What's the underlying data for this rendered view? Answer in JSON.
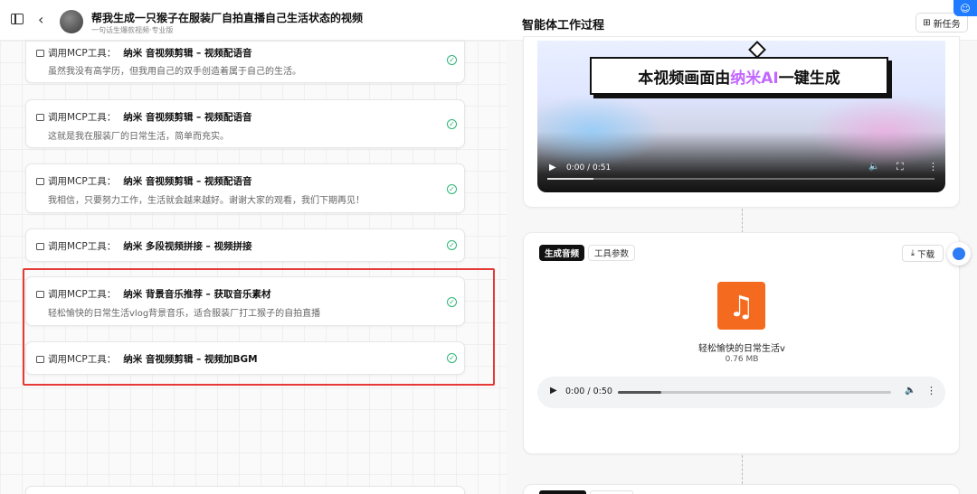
{
  "header": {
    "title": "帮我生成一只猴子在服装厂自拍直播自己生活状态的视频",
    "subtitle": "一句话生爆款视频·专业版",
    "center_title": "智能体工作过程",
    "new_task_label": "新任务",
    "corner_icon": "robot-icon"
  },
  "steps": [
    {
      "prefix": "调用MCP工具：",
      "tool": "纳米 音视频剪辑 – 视频配语音",
      "desc": "虽然我没有高学历，但我用自己的双手创造着属于自己的生活。"
    },
    {
      "prefix": "调用MCP工具：",
      "tool": "纳米 音视频剪辑 – 视频配语音",
      "desc": "这就是我在服装厂的日常生活，简单而充实。"
    },
    {
      "prefix": "调用MCP工具：",
      "tool": "纳米 音视频剪辑 – 视频配语音",
      "desc": "我相信，只要努力工作，生活就会越来越好。谢谢大家的观看，我们下期再见！"
    },
    {
      "prefix": "调用MCP工具：",
      "tool": "纳米 多段视频拼接 – 视频拼接",
      "desc": ""
    },
    {
      "prefix": "调用MCP工具：",
      "tool": "纳米 背景音乐推荐 – 获取音乐素材",
      "desc": "轻松愉快的日常生活vlog背景音乐，适合服装厂打工猴子的自拍直播"
    },
    {
      "prefix": "调用MCP工具：",
      "tool": "纳米 音视频剪辑 – 视频加BGM",
      "desc": ""
    }
  ],
  "video": {
    "banner_before": "本视频画面由",
    "banner_highlight": "纳米AI",
    "banner_after": "一键生成",
    "time": "0:00 / 0:51",
    "progress": 0.12
  },
  "audio_card": {
    "tab_active": "生成音频",
    "tab_inactive": "工具参数",
    "download_label": "下载",
    "file_name": "轻松愉快的日常生活v",
    "file_size": "0.76 MB",
    "time": "0:00 / 0:50",
    "progress": 0.16
  },
  "colors": {
    "accent": "#1f7bff",
    "highlight_box": "#e53935",
    "success": "#2bb673",
    "music_tile": "#f46b1f"
  }
}
